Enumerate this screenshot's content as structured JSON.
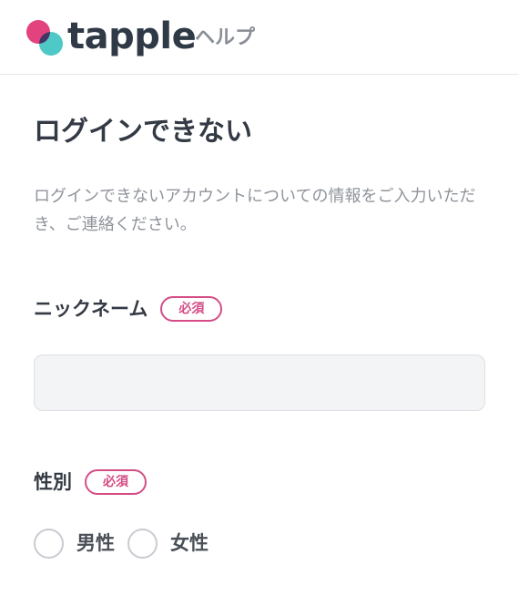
{
  "header": {
    "brand": "tapple",
    "help": "ヘルプ",
    "colors": {
      "pink": "#e2437f",
      "teal": "#4fc8c8"
    }
  },
  "page": {
    "title": "ログインできない",
    "description": "ログインできないアカウントについての情報をご入力いただき、ご連絡ください。"
  },
  "form": {
    "nickname": {
      "label": "ニックネーム",
      "required": "必須",
      "value": "",
      "placeholder": ""
    },
    "gender": {
      "label": "性別",
      "required": "必須",
      "options": [
        "男性",
        "女性"
      ]
    }
  },
  "colors": {
    "accent": "#d44d86",
    "text": "#333a44",
    "muted": "#8f949b"
  }
}
